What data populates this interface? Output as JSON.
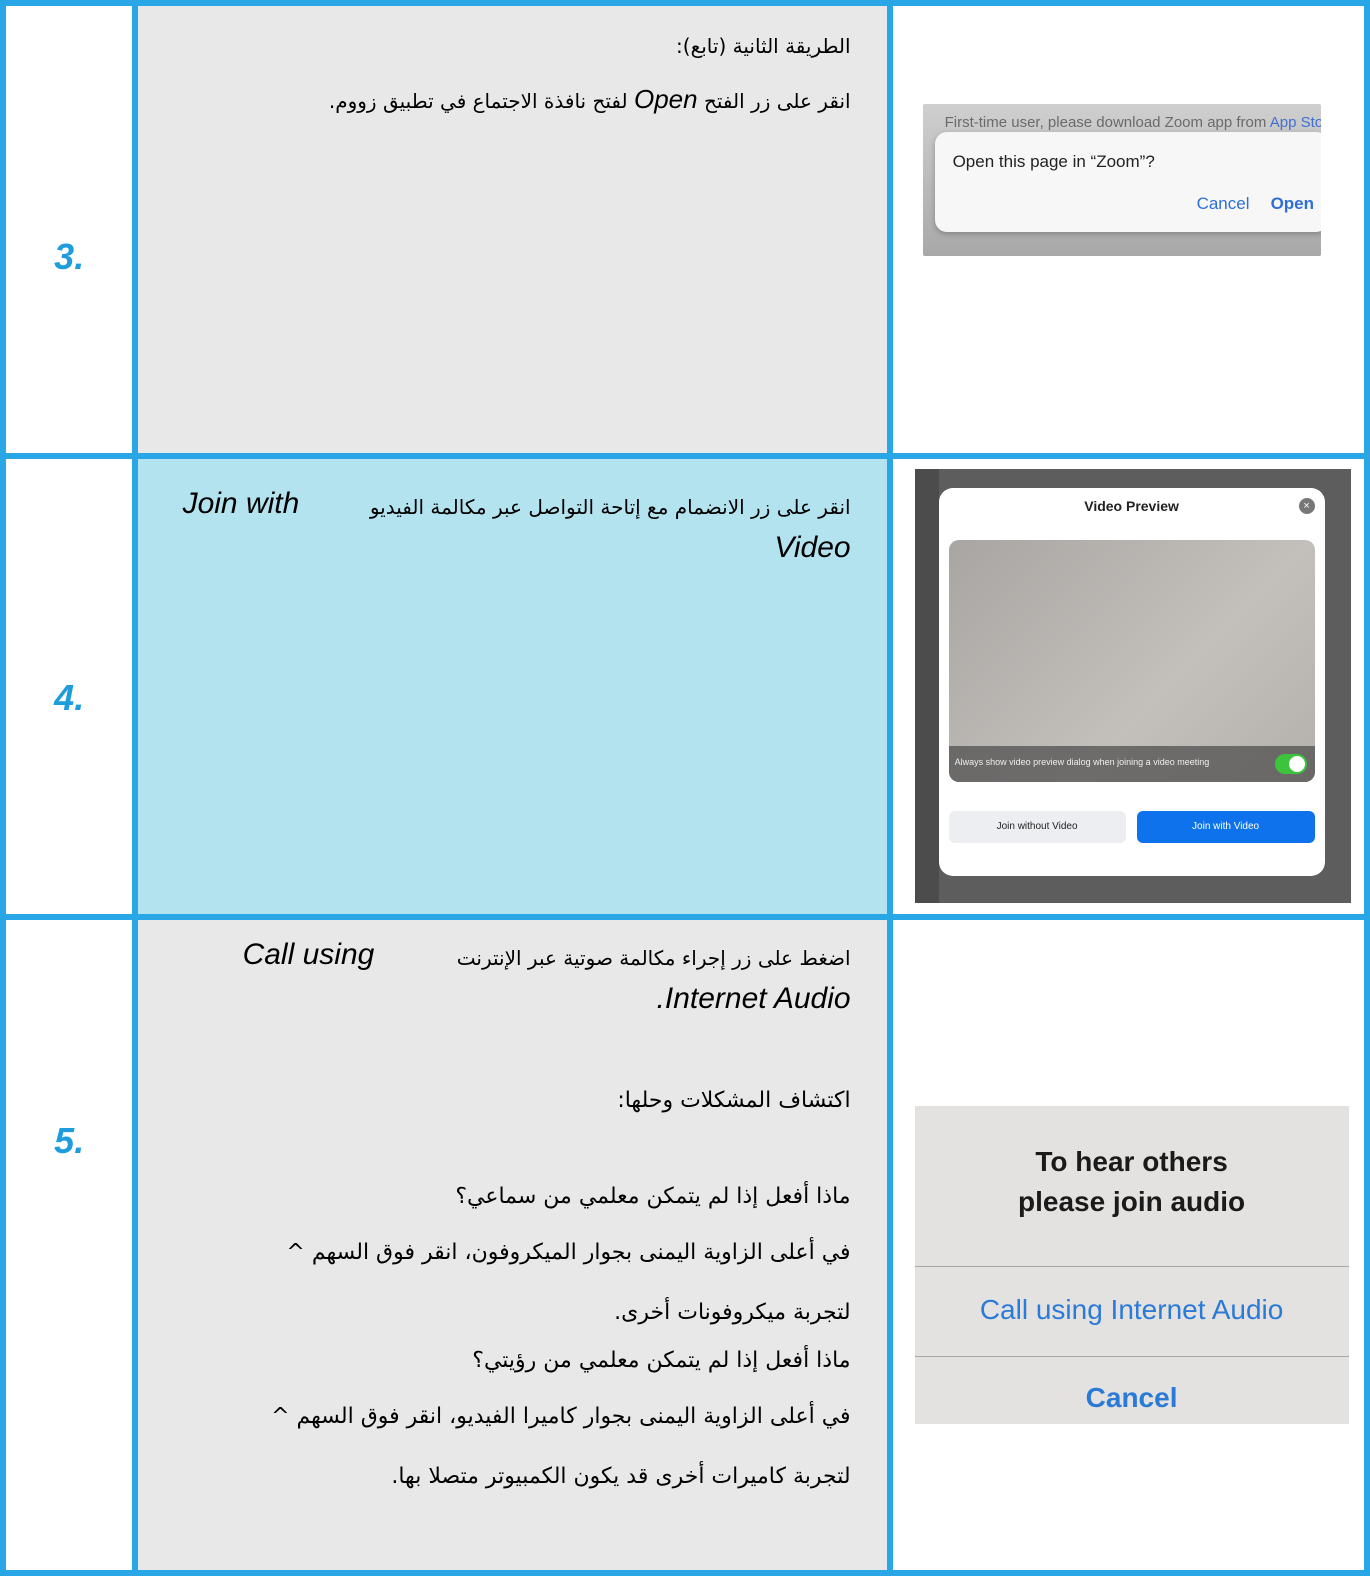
{
  "colors": {
    "border": "#29a6e6",
    "step_number": "#1e9cdc",
    "row_gray": "#e8e8e8",
    "row_blue": "#b4e3f0",
    "zoom_blue": "#0e72ed"
  },
  "rows": [
    {
      "number": "3.",
      "text_line1": "الطريقة الثانية (تابع):",
      "text_line2_before": "انقر على زر الفتح",
      "text_line2_italic": "Open",
      "text_line2_after": "لفتح نافذة الاجتماع في تطبيق زووم.",
      "screenshot": {
        "background_line": "First-time user, please download Zoom app from",
        "background_link": "App Store",
        "prompt": "Open this page in “Zoom”?",
        "cancel": "Cancel",
        "open": "Open"
      }
    },
    {
      "number": "4.",
      "text_arabic": "انقر على زر الانضمام مع إتاحة التواصل عبر مكالمة الفيديو",
      "text_italic_1": "Join with",
      "text_italic_2": "Video",
      "screenshot": {
        "title": "Video Preview",
        "close_glyph": "×",
        "checkbox_text": "Always show video preview dialog when joining a video meeting",
        "btn_without": "Join without Video",
        "btn_with": "Join with Video"
      }
    },
    {
      "number": "5.",
      "line1_arabic": "اضغط على زر إجراء مكالمة صوتية عبر الإنترنت",
      "line1_italic": "Call using",
      "line2_italic": ".Internet Audio",
      "troubleshoot_title": "اكتشاف المشكلات وحلها:",
      "q1": "ماذا أفعل إذا لم يتمكن معلمي من سماعي؟",
      "a1_line1": " في أعلى الزاوية اليمنى بجوار الميكروفون، انقر فوق السهم ^",
      "a1_line2": "لتجربة ميكروفونات أخرى.",
      "q2": "ماذا أفعل إذا لم يتمكن معلمي من رؤيتي؟",
      "a2_line1": " في أعلى الزاوية اليمنى بجوار كاميرا الفيديو، انقر فوق السهم ^",
      "a2_line2": "لتجربة كاميرات أخرى قد يكون الكمبيوتر متصلا بها.",
      "screenshot": {
        "line1": "To hear others",
        "line2": "please join audio",
        "call": "Call using Internet Audio",
        "cancel": "Cancel"
      }
    }
  ]
}
